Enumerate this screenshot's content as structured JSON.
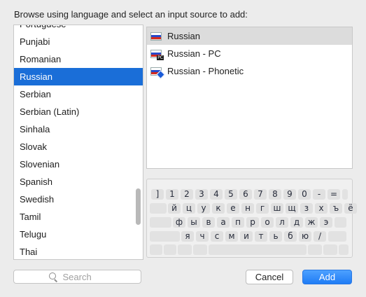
{
  "dialog": {
    "title": "Browse using language and select an input source to add:"
  },
  "languages": {
    "items": [
      "Portuguese",
      "Punjabi",
      "Romanian",
      "Russian",
      "Serbian",
      "Serbian (Latin)",
      "Sinhala",
      "Slovak",
      "Slovenian",
      "Spanish",
      "Swedish",
      "Tamil",
      "Telugu",
      "Thai"
    ],
    "selected": "Russian"
  },
  "sources": {
    "items": [
      {
        "label": "Russian",
        "badge": "",
        "icon": "russian-flag-icon"
      },
      {
        "label": "Russian - PC",
        "badge": "PC",
        "icon": "russian-flag-pc-icon"
      },
      {
        "label": "Russian - Phonetic",
        "badge": "phonetic",
        "icon": "russian-flag-phonetic-icon"
      }
    ],
    "highlighted": "Russian"
  },
  "keyboard": {
    "row1": [
      "]",
      "1",
      "2",
      "3",
      "4",
      "5",
      "6",
      "7",
      "8",
      "9",
      "0",
      "-",
      "="
    ],
    "row2": [
      "й",
      "ц",
      "у",
      "к",
      "е",
      "н",
      "г",
      "ш",
      "щ",
      "з",
      "х",
      "ъ",
      "ё"
    ],
    "row3": [
      "ф",
      "ы",
      "в",
      "а",
      "п",
      "р",
      "о",
      "л",
      "д",
      "ж",
      "э"
    ],
    "row4": [
      "я",
      "ч",
      "с",
      "м",
      "и",
      "т",
      "ь",
      "б",
      "ю",
      "/"
    ]
  },
  "search": {
    "placeholder": "Search",
    "icon": "magnifier-icon"
  },
  "buttons": {
    "cancel": "Cancel",
    "add": "Add"
  },
  "colors": {
    "selection": "#1a6ed8",
    "accent_button": "#2b87f7",
    "background": "#ececec"
  }
}
